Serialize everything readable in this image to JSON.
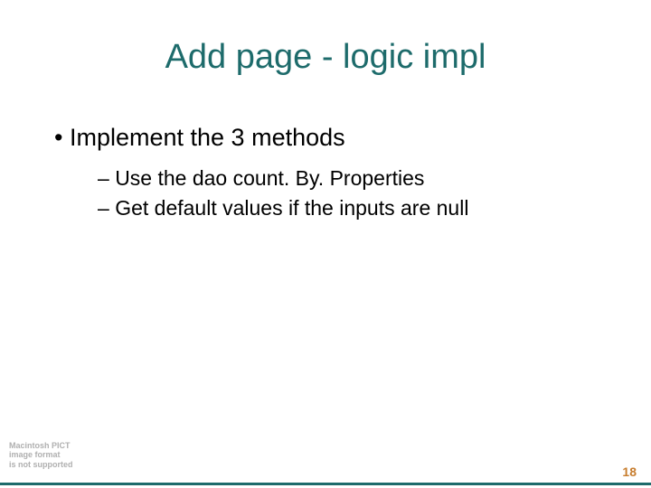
{
  "title": "Add page - logic impl",
  "bullets": {
    "l1": "Implement the 3 methods",
    "l2a": "Use the dao count. By. Properties",
    "l2b": "Get default values if the inputs are null"
  },
  "pict": {
    "line1": "Macintosh PICT",
    "line2": "image format",
    "line3": "is not supported"
  },
  "page_number": "18"
}
